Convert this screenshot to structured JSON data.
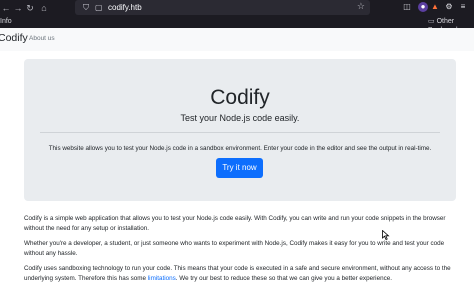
{
  "browser": {
    "tab_label": "Info",
    "url": "codify.htb",
    "bookmarks_label": "Other Bookmarks"
  },
  "site_nav": {
    "brand": "Codify",
    "links": [
      "About us"
    ]
  },
  "hero": {
    "title": "Codify",
    "lead": "Test your Node.js code easily.",
    "description": "This website allows you to test your Node.js code in a sandbox environment. Enter your code in the editor and see the output in real-time.",
    "button_label": "Try it now"
  },
  "content": {
    "p1": "Codify is a simple web application that allows you to test your Node.js code easily. With Codify, you can write and run your code snippets in the browser without the need for any setup or installation.",
    "p2": "Whether you're a developer, a student, or just someone who wants to experiment with Node.js, Codify makes it easy for you to write and test your code without any hassle.",
    "p3_before": "Codify uses sandboxing technology to run your code. This means that your code is executed in a safe and secure environment, without any access to the underlying system. Therefore this has some ",
    "p3_link": "limitations",
    "p3_after": ". We try our best to reduce these so that we can give you a better experience."
  },
  "colors": {
    "accent": "#0d6efd",
    "hero_bg": "#e9ecef",
    "chrome_bg": "#1c1b22"
  }
}
